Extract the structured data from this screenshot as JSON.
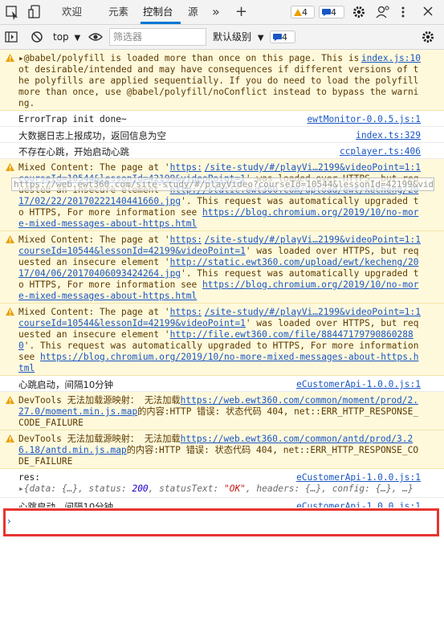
{
  "toolbar": {
    "tabs": [
      "欢迎",
      "元素",
      "控制台",
      "源"
    ],
    "more_label": "»",
    "add_label": "+",
    "warn_count": "4",
    "info_count": "4"
  },
  "filterbar": {
    "context": "top",
    "filter_placeholder": "筛选器",
    "level": "默认级别",
    "issues_count": "4"
  },
  "messages": {
    "m1": {
      "text": "▸@babel/polyfill is loaded more than once on this page. This is probably not desirable/intended and may have consequences if different versions of the polyfills are applied sequentially. If you do need to load the polyfill more than once, use @babel/polyfill/noConflict instead to bypass the warning.",
      "source": "index.js:10"
    },
    "m2": {
      "text": "ErrorTrap init done~",
      "source": "ewtMonitor-0.0.5.js:1"
    },
    "m3": {
      "text": "大数据日志上报成功，返回信息为空",
      "source": "index.ts:329"
    },
    "m4": {
      "text": "不存在心跳，开始启动心跳",
      "source": "ccplayer.ts:406"
    },
    "m5": {
      "pre": "Mixed Content: The page at '",
      "page": "https://web.ewt360.com/site-study/#/playVideo?courseId=10544&lessonId=42199&videoPoint=1",
      "mid": "' was loaded over HTTPS, but requested an insecure element '",
      "element": "http://static.ewt360.com/upload/ewt/kecheng/2017/02/22/20170222140441660.jpg",
      "post": "'. This request was automatically upgraded to HTTPS, For more information see ",
      "info": "https://blog.chromium.org/2019/10/no-more-mixed-messages-about-https.html",
      "source": "/site-study/#/playVi…2199&videoPoint=1:1"
    },
    "m6": {
      "pre": "Mixed Content: The page at '",
      "page": "https://web.ewt360.com/site-study/#/playVideo?courseId=10544&lessonId=42199&videoPoint=1",
      "mid": "' was loaded over HTTPS, but requested an insecure element '",
      "element": "http://static.ewt360.com/upload/ewt/kecheng/2017/04/06/20170406093424264.jpg",
      "post": "'. This request was automatically upgraded to HTTPS, For more information see ",
      "info": "https://blog.chromium.org/2019/10/no-more-mixed-messages-about-https.html",
      "source": "/site-study/#/playVi…2199&videoPoint=1:1"
    },
    "m7": {
      "pre": "Mixed Content: The page at '",
      "page": "https://web.ewt360.com/site-study/#/playVideo?courseId=10544&lessonId=42199&videoPoint=1",
      "mid": "' was loaded over HTTPS, but requested an insecure element '",
      "element": "http://file.ewt360.com/file/884471797908602880",
      "post": "'. This request was automatically upgraded to HTTPS, For more information see ",
      "info": "https://blog.chromium.org/2019/10/no-more-mixed-messages-about-https.html",
      "source": "/site-study/#/playVi…2199&videoPoint=1:1"
    },
    "m8": {
      "text": "心跳启动，间隔10分钟",
      "source": "eCustomerApi-1.0.0.js:1"
    },
    "m9": {
      "pre": "DevTools 无法加载源映射： 无法加载",
      "url": "https://web.ewt360.com/common/moment/prod/2.27.0/moment.min.js.map",
      "post": "的内容:HTTP 错误: 状态代码 404, net::ERR_HTTP_RESPONSE_CODE_FAILURE"
    },
    "m10": {
      "pre": "DevTools 无法加载源映射： 无法加载",
      "url": "https://web.ewt360.com/common/antd/prod/3.26.18/antd.min.js.map",
      "post": "的内容:HTTP 错误: 状态代码 404, net::ERR_HTTP_RESPONSE_CODE_FAILURE"
    },
    "m11": {
      "label": "res:",
      "source": "eCustomerApi-1.0.0.js:1",
      "obj_pre": "▸{data: {…}, status: ",
      "obj_status": "200",
      "obj_mid": ", statusText: ",
      "obj_text": "\"OK\"",
      "obj_post": ", headers: {…}, config: {…}, …}"
    },
    "m12": {
      "text": "心跳启动，间隔10分钟",
      "source": "eCustomerApi-1.0.0.js:1"
    }
  },
  "tooltip": "https://web.ewt360.com/site-study/#/playVideo?courseId=10544&lessonId=42199&videoPoint=1",
  "prompt": {
    "chevron": "›"
  }
}
